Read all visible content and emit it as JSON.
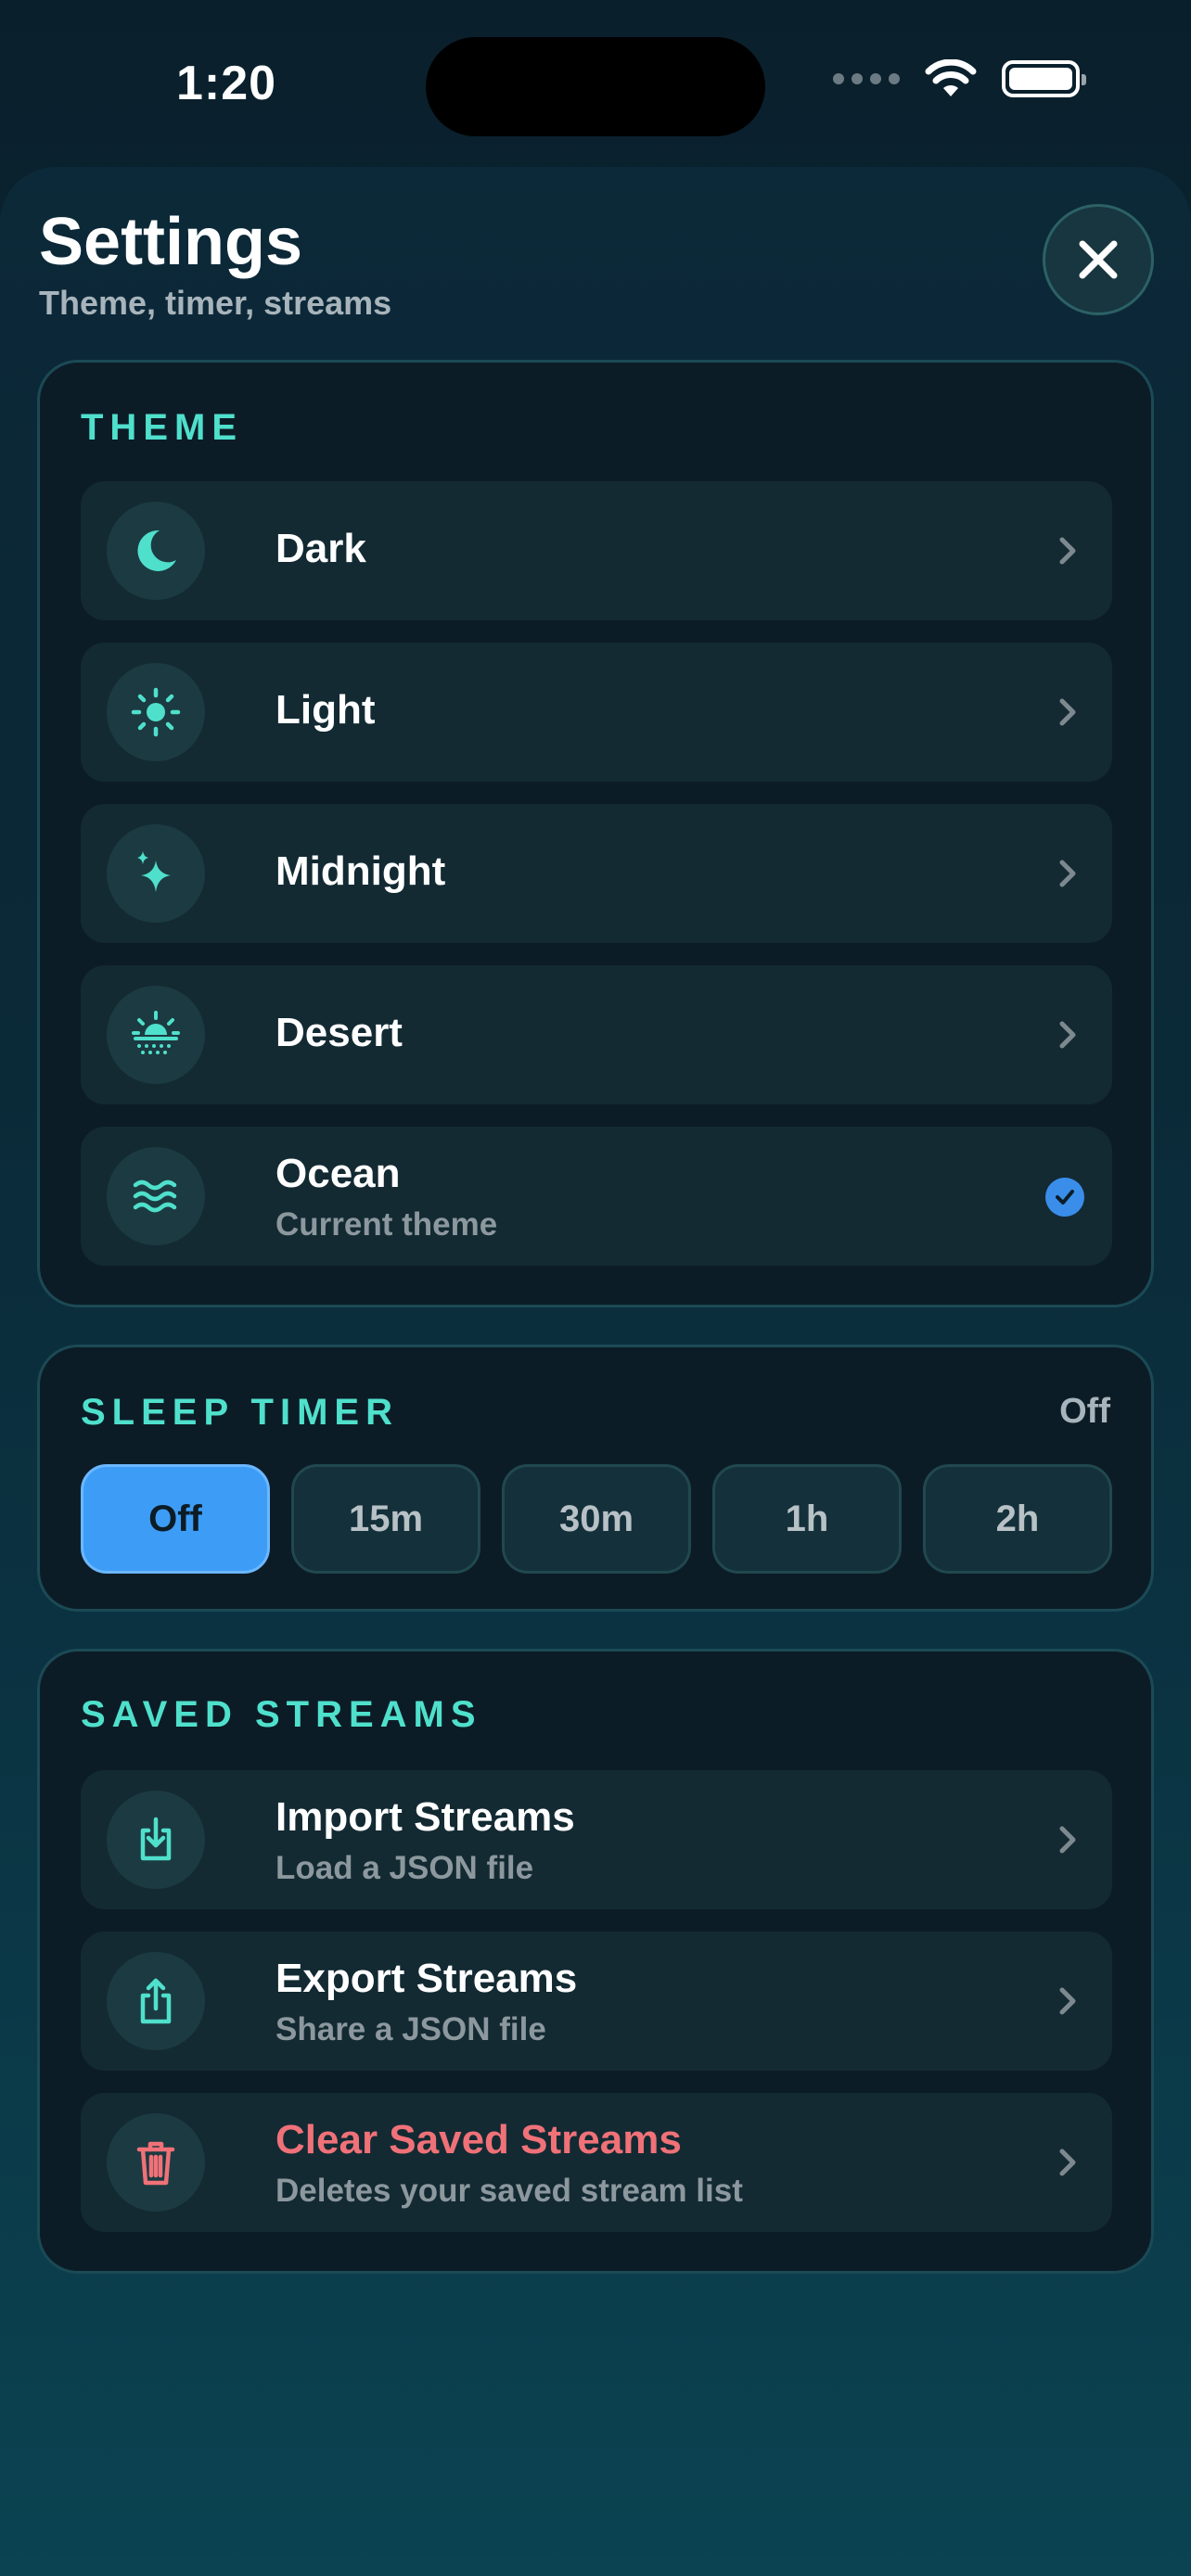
{
  "status_bar": {
    "time": "1:20"
  },
  "header": {
    "title": "Settings",
    "subtitle": "Theme, timer, streams",
    "close_icon": "close-icon"
  },
  "theme": {
    "title": "THEME",
    "items": [
      {
        "label": "Dark",
        "icon": "moon-icon"
      },
      {
        "label": "Light",
        "icon": "sun-icon"
      },
      {
        "label": "Midnight",
        "icon": "sparkles-icon"
      },
      {
        "label": "Desert",
        "icon": "sunset-icon"
      },
      {
        "label": "Ocean",
        "sublabel": "Current theme",
        "icon": "waves-icon",
        "selected": true
      }
    ]
  },
  "sleep_timer": {
    "title": "SLEEP TIMER",
    "current_value": "Off",
    "options": [
      "Off",
      "15m",
      "30m",
      "1h",
      "2h"
    ],
    "selected": "Off"
  },
  "saved_streams": {
    "title": "SAVED STREAMS",
    "items": [
      {
        "label": "Import Streams",
        "sublabel": "Load a JSON file",
        "icon": "import-icon"
      },
      {
        "label": "Export Streams",
        "sublabel": "Share a JSON file",
        "icon": "share-icon"
      },
      {
        "label": "Clear Saved Streams",
        "sublabel": "Deletes your saved stream list",
        "icon": "trash-icon",
        "destructive": true
      }
    ]
  },
  "colors": {
    "accent": "#4fe0cc",
    "selected": "#3d9df6",
    "destructive": "#f07178",
    "card_bg": "#0c1c26",
    "row_bg": "#132a33"
  }
}
